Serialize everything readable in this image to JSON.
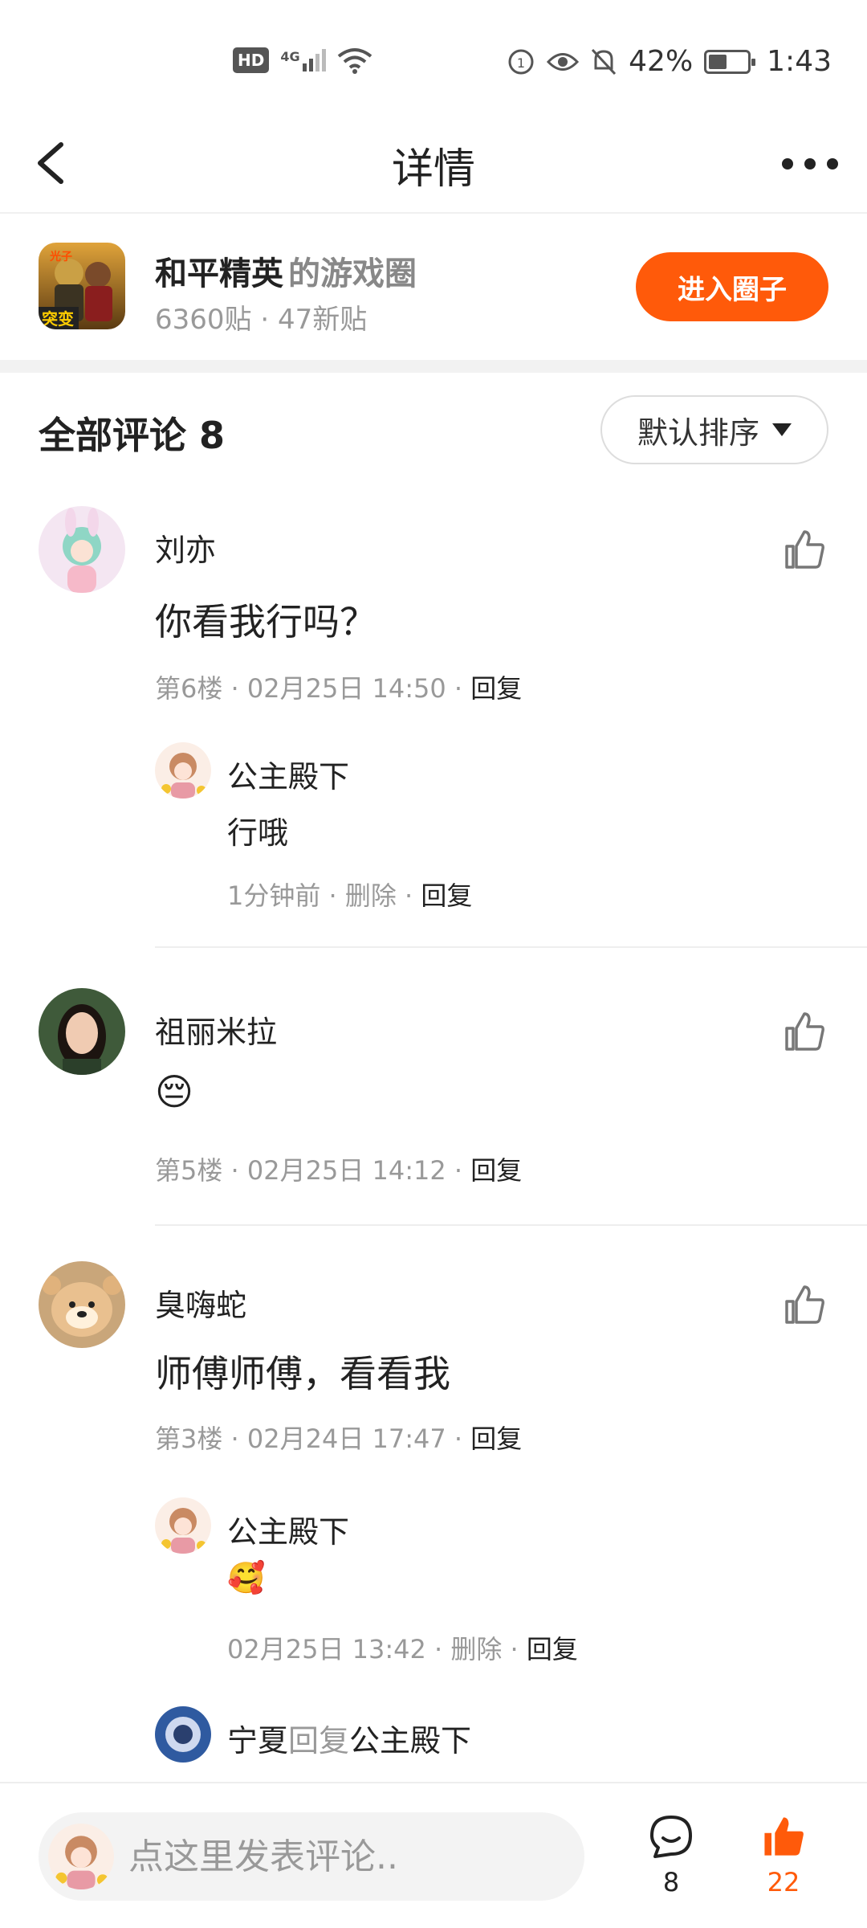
{
  "status_bar": {
    "left_badge": "HD",
    "network": "4G",
    "battery": "42%",
    "time": "1:43"
  },
  "nav": {
    "title": "详情"
  },
  "circle": {
    "name": "和平精英",
    "suffix": "的游戏圈",
    "stats": "6360贴 · 47新贴",
    "join_label": "进入圈子",
    "icon_text": "突变",
    "icon_tag": "光子"
  },
  "comments_header": {
    "title": "全部评论 8",
    "sort_label": "默认排序"
  },
  "comments": [
    {
      "user": "刘亦",
      "text": "你看我行吗？",
      "meta": "第6楼 · 02月25日 14:50 · ",
      "reply_label": "回复",
      "replies": [
        {
          "user": "公主殿下",
          "text": "行哦",
          "meta": "1分钟前 · 删除 · ",
          "reply_label": "回复"
        }
      ]
    },
    {
      "user": "祖丽米拉",
      "text": "😔",
      "meta": "第5楼 · 02月25日 14:12 · ",
      "reply_label": "回复"
    },
    {
      "user": "臭嗨蛇",
      "text": "师傅师傅，看看我",
      "meta": "第3楼 · 02月24日 17:47 · ",
      "reply_label": "回复",
      "replies": [
        {
          "user": "公主殿下",
          "text": "🥰",
          "meta": "02月25日 13:42 · 删除 · ",
          "reply_label": "回复"
        },
        {
          "user": "宁夏",
          "reply_word": "回复",
          "reply_to": "公主殿下"
        }
      ]
    }
  ],
  "bottom_bar": {
    "input_placeholder": "点这里发表评论..",
    "comment_count": "8",
    "like_count": "22",
    "accent": "#ff5a0a"
  }
}
